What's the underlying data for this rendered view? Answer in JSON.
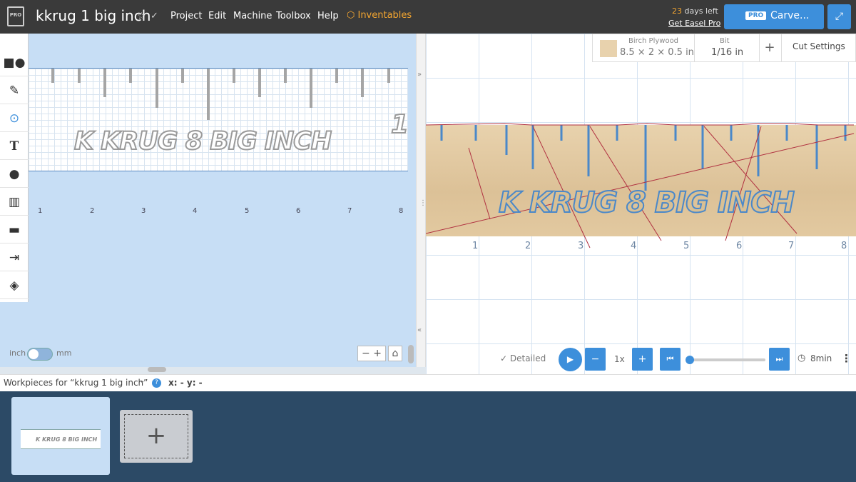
{
  "header": {
    "logo_badge": "PRO",
    "project_title": "kkrug 1 big inch",
    "menu": [
      "Project",
      "Edit",
      "Machine",
      "Toolbox",
      "Help"
    ],
    "inventables": "Inventables",
    "trial_days": "23",
    "trial_suffix": " days left",
    "get_pro": "Get Easel Pro",
    "carve_badge": "PRO",
    "carve_label": "Carve..."
  },
  "design": {
    "text": "K KRUG 8 BIG INCH",
    "cut_digit": "1",
    "ruler_numbers": [
      "1",
      "2",
      "3",
      "4",
      "5",
      "6",
      "7",
      "8"
    ],
    "unit_left": "inch",
    "unit_right": "mm",
    "zoom_out": "−",
    "zoom_in": "+",
    "home": "⌂"
  },
  "preview": {
    "material_name": "Birch Plywood",
    "material_size": "8.5 × 2 × 0.5 in",
    "bit_label": "Bit",
    "bit_value": "1/16 in",
    "add": "+",
    "cut_settings": "Cut Settings",
    "ruler_numbers": [
      "1",
      "2",
      "3",
      "4",
      "5",
      "6",
      "7",
      "8"
    ],
    "text": "K KRUG 8 BIG INCH",
    "detailed": "✓ Detailed",
    "speed": "1x",
    "time": "8min"
  },
  "workpieces": {
    "label": "Workpieces for “kkrug 1 big inch”",
    "coords": "x: - y: -",
    "thumb_text": "K KRUG 8 BIG INCH"
  },
  "colors": {
    "accent": "#3d8fdb",
    "warning": "#f3a530",
    "tray": "#2c4a66"
  }
}
